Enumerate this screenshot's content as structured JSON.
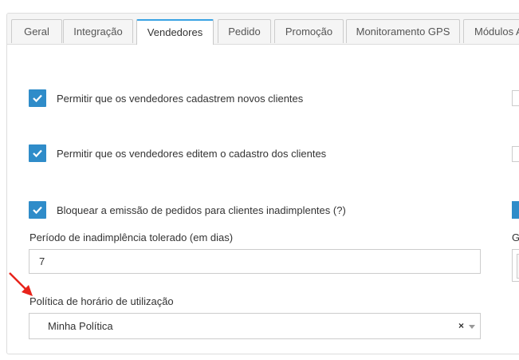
{
  "tabs": [
    {
      "label": "Geral",
      "active": false
    },
    {
      "label": "Integração",
      "active": false
    },
    {
      "label": "Vendedores",
      "active": true
    },
    {
      "label": "Pedido",
      "active": false
    },
    {
      "label": "Promoção",
      "active": false
    },
    {
      "label": "Monitoramento GPS",
      "active": false
    },
    {
      "label": "Módulos A",
      "active": false
    }
  ],
  "settings": {
    "allow_register_clients": {
      "label": "Permitir que os vendedores cadastrem novos clientes",
      "checked": true
    },
    "allow_edit_clients": {
      "label": "Permitir que os vendedores editem o cadastro dos clientes",
      "checked": true
    },
    "block_defaulters": {
      "label": "Bloquear a emissão de pedidos para clientes inadimplentes (?)",
      "checked": true
    },
    "tolerance_period": {
      "label": "Período de inadimplência tolerado (em dias)",
      "value": "7"
    },
    "usage_policy": {
      "label": "Política de horário de utilização",
      "value": "Minha Política",
      "clear_icon": "×"
    }
  },
  "right_column": {
    "partial_label": "G"
  },
  "colors": {
    "checkbox": "#2f8cc9",
    "active_tab_accent": "#3aa3e3",
    "arrow": "#e8231b"
  }
}
